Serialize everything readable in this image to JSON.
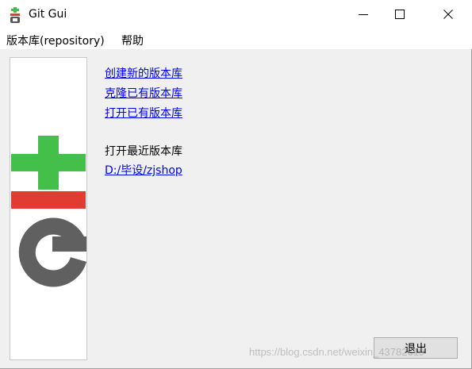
{
  "window": {
    "title": "Git Gui",
    "minimize_icon": "minimize-icon",
    "maximize_icon": "maximize-icon",
    "close_icon": "close-icon"
  },
  "menubar": {
    "items": [
      "版本库(repository)",
      "帮助"
    ]
  },
  "logo": {
    "icon": "git-logo-icon",
    "colors": {
      "plus": "#44c04a",
      "bar": "#e03c31",
      "g": "#606060"
    }
  },
  "actions": {
    "create_new": "创建新的版本库",
    "clone_existing": "克隆已有版本库",
    "open_existing": "打开已有版本库"
  },
  "recent": {
    "label": "打开最近版本库",
    "repos": [
      "D:/毕设/zjshop"
    ]
  },
  "footer": {
    "quit_label": "退出",
    "watermark": "https://blog.csdn.net/weixin_43782619"
  },
  "colors": {
    "link": "#0000ee"
  }
}
